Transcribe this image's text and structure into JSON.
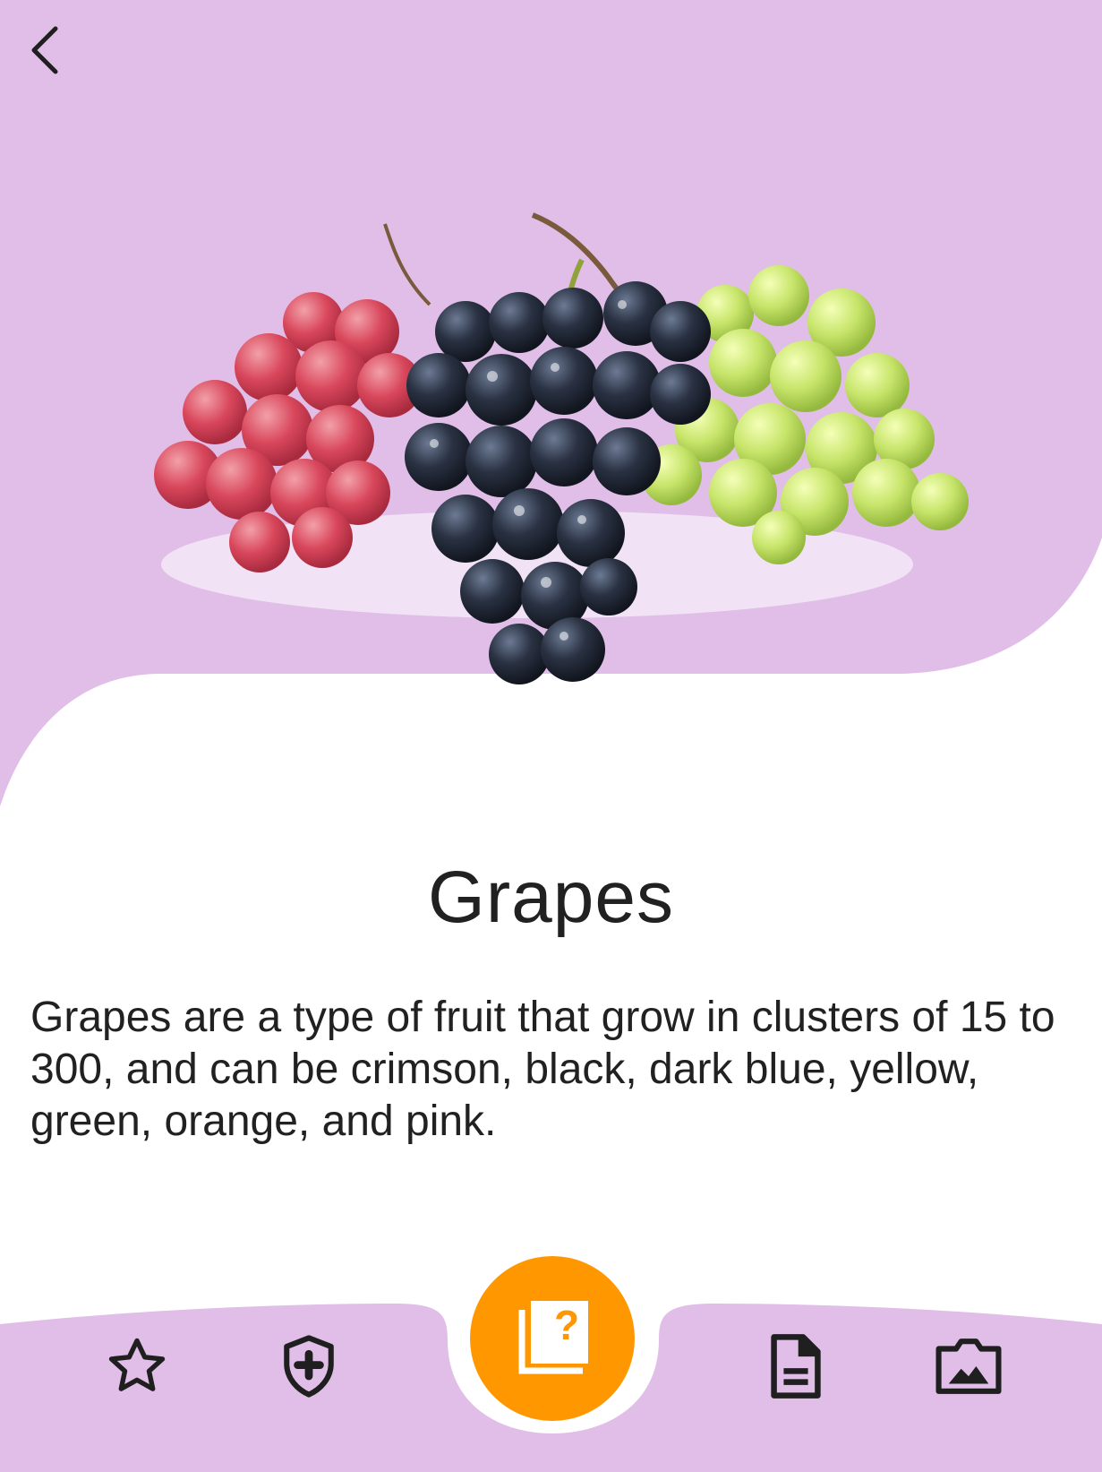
{
  "colors": {
    "header_bg": "#e0bee8",
    "nav_bg": "#e0bee8",
    "fab": "#ff9800",
    "text": "#212121",
    "icon": "#1f1f1f"
  },
  "header": {
    "back_icon": "chevron-left-icon"
  },
  "fruit": {
    "name": "Grapes",
    "description": "Grapes are a type of fruit that grow in clusters of 15 to 300, and can be crimson, black, dark blue, yellow, green, orange, and pink.",
    "image": "grapes-image"
  },
  "bottom_nav": {
    "items": [
      {
        "icon": "star-icon"
      },
      {
        "icon": "shield-plus-icon"
      },
      {
        "icon": "quiz-cards-icon",
        "glyph": "?"
      },
      {
        "icon": "document-icon"
      },
      {
        "icon": "image-gallery-icon"
      }
    ]
  }
}
